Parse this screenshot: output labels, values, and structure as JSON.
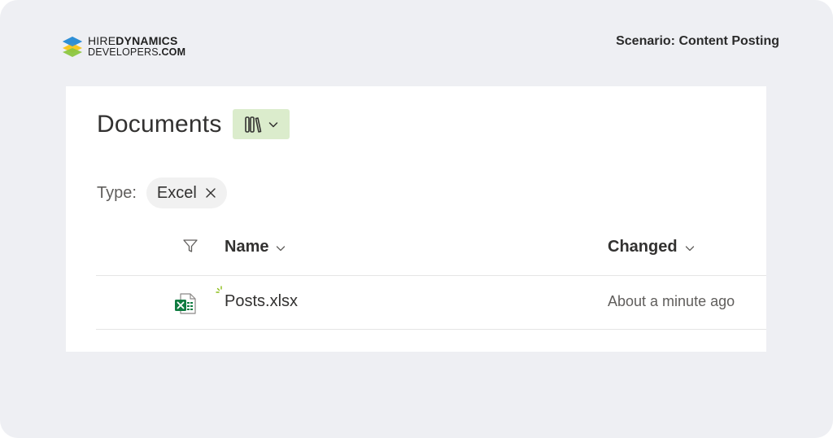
{
  "brand": {
    "line1_light": "HIRE",
    "line1_bold": "DYNAMICS",
    "line2_light": "DEVELOPERS",
    "line2_bold": ".COM"
  },
  "scenario": "Scenario: Content Posting",
  "library": {
    "title": "Documents",
    "view_icon": "library-icon",
    "view_dropdown_icon": "chevron-down-icon"
  },
  "filter": {
    "label": "Type:",
    "chip_value": "Excel",
    "chip_close_icon": "close-icon"
  },
  "columns": {
    "filter_icon": "filter-icon",
    "name": "Name",
    "changed": "Changed"
  },
  "rows": [
    {
      "icon": "excel-file-icon",
      "name": "Posts.xlsx",
      "changed": "About a minute ago",
      "new_indicator": "new-file-sparkle-icon"
    }
  ],
  "colors": {
    "background": "#eeeff3",
    "panel": "#ffffff",
    "view_button": "#dbeccc",
    "excel_green": "#107c41",
    "new_indicator": "#8cbd18",
    "logo_blue": "#2f8fd6",
    "logo_yellow": "#f5c518",
    "logo_green": "#8cc63f"
  }
}
